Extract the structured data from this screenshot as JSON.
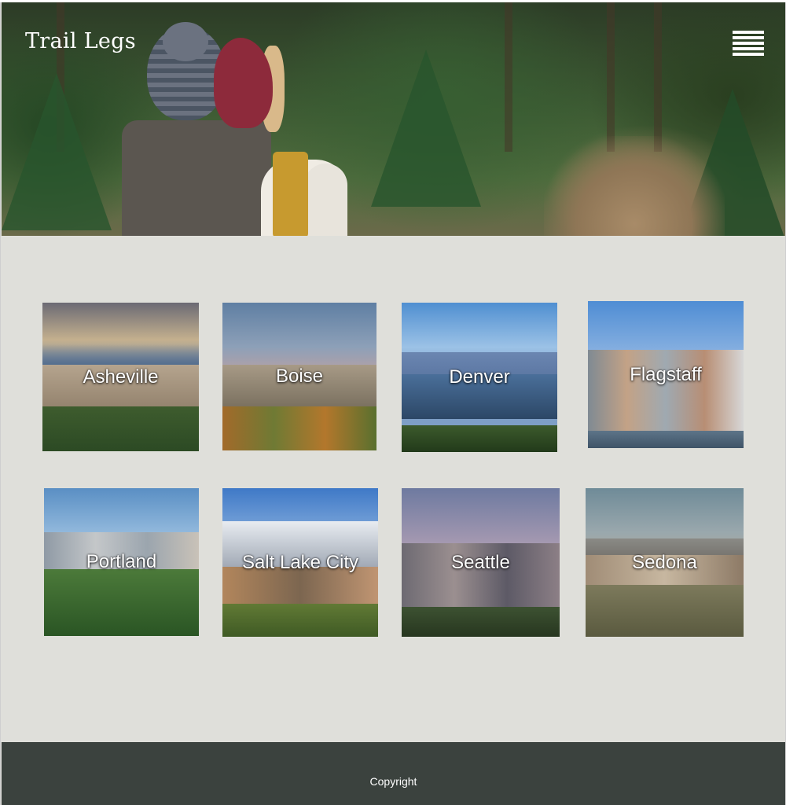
{
  "header": {
    "brand": "Trail Legs",
    "menu_icon": "hamburger-menu-icon"
  },
  "destinations": [
    {
      "label": "Asheville"
    },
    {
      "label": "Boise"
    },
    {
      "label": "Denver"
    },
    {
      "label": "Flagstaff"
    },
    {
      "label": "Portland"
    },
    {
      "label": "Salt Lake City"
    },
    {
      "label": "Seattle"
    },
    {
      "label": "Sedona"
    }
  ],
  "footer": {
    "copyright": "Copyright"
  },
  "colors": {
    "page_background": "#dfdfda",
    "footer_background": "#3b423e",
    "text_on_image": "#ffffff"
  }
}
